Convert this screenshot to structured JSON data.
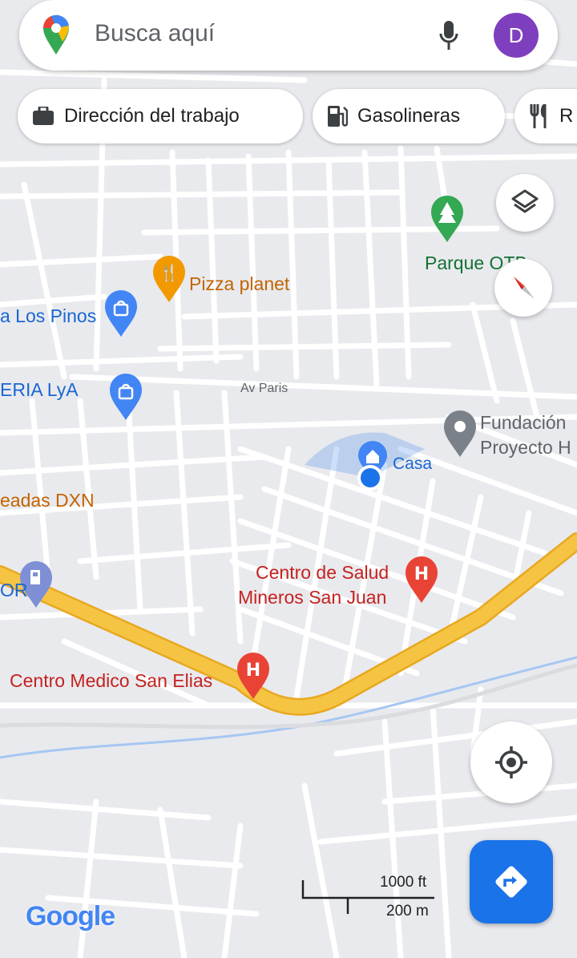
{
  "search": {
    "placeholder": "Busca aquí",
    "avatar_letter": "D"
  },
  "chips": [
    {
      "label": "Dirección del trabajo",
      "icon": "briefcase-icon"
    },
    {
      "label": "Gasolineras",
      "icon": "gas-station-icon"
    },
    {
      "label": "R",
      "icon": "restaurant-icon"
    }
  ],
  "places": {
    "pizza": "Pizza planet",
    "parque": "Parque OTB",
    "pinos": "a Los Pinos",
    "eria": "ERIA LyA",
    "fundacion_1": "Fundación",
    "fundacion_2": "Proyecto H",
    "casa": "Casa",
    "deadas": "eadas DXN",
    "salud_1": "Centro de Salud",
    "salud_2": "Mineros San Juan",
    "gas_station": "OR",
    "medico": "Centro Medico San Elias"
  },
  "streets": {
    "av_paris": "Av Paris"
  },
  "scale": {
    "feet": "1000 ft",
    "meters": "200 m"
  },
  "brand": {
    "google": "Google"
  },
  "colors": {
    "highway": "#f6c443",
    "road": "#ffffff",
    "land": "#e9eaee",
    "river": "#a7c7f2",
    "location": "#1a73e8",
    "hospital": "#e94335",
    "food": "#f29900",
    "shopping": "#4285f4",
    "park": "#34a853"
  }
}
